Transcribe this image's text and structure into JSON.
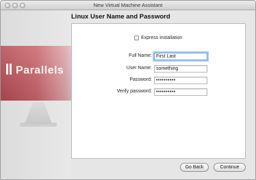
{
  "window": {
    "title": "New Virtual Machine Assistant"
  },
  "sidebar": {
    "brand_logo": "Parallels"
  },
  "page": {
    "title": "Linux User Name and Password"
  },
  "form": {
    "express_installation": {
      "label": "Express installation",
      "checked": false
    },
    "fields": [
      {
        "label": "Full Name:",
        "value": "First Last",
        "type": "text",
        "focused": true
      },
      {
        "label": "User Name:",
        "value": "something",
        "type": "text",
        "focused": false
      },
      {
        "label": "Password:",
        "value": "••••••••••",
        "type": "password",
        "focused": false
      },
      {
        "label": "Verify password:",
        "value": "••••••••••",
        "type": "password",
        "focused": false
      }
    ]
  },
  "buttons": {
    "go_back": "Go Back",
    "continue": "Continue"
  },
  "colors": {
    "focus_ring": "#a9ccf1",
    "brand_red": "#b14a52"
  }
}
